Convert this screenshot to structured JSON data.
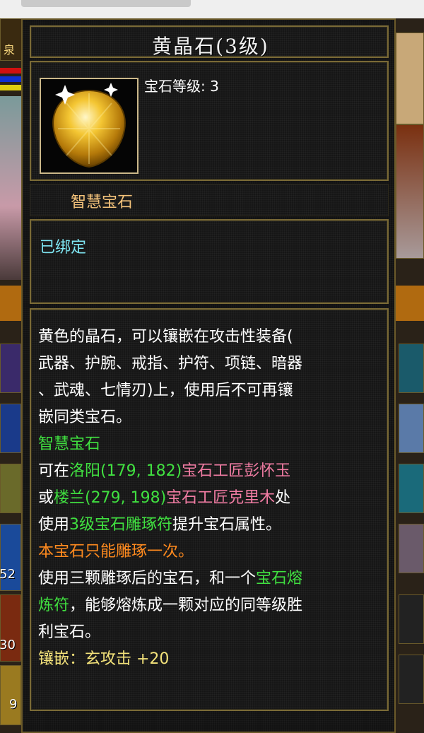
{
  "tooltip": {
    "title": "黄晶石(3级)",
    "gem_level": "宝石等级: 3",
    "category": "智慧宝石",
    "bound": "已绑定",
    "description": {
      "lines": [
        "黄色的晶石，可以镶嵌在攻击性装备(",
        "武器、护腕、戒指、护符、项链、暗器",
        "、武魂、七情刃)上，使用后不可再镶",
        "嵌同类宝石。"
      ],
      "type_label": "智慧宝石",
      "craft": {
        "line1_prefix": "可在",
        "loc1": "洛阳(179, 182)",
        "npc1": "宝石工匠彭怀玉",
        "line2_prefix": "或",
        "loc2": "楼兰(279, 198)",
        "npc2": "宝石工匠克里木",
        "line2_suffix": "处",
        "line3_prefix": "使用",
        "item": "3级宝石雕琢符",
        "line3_suffix": "提升宝石属性。"
      },
      "warning": "本宝石只能雕琢一次。",
      "fuse": {
        "part1": "使用三颗雕琢后的宝石，和一个",
        "item": "宝石熔",
        "item2": "炼符",
        "part2": "，能够熔炼成一颗对应的同等级胜",
        "part3": "利宝石。"
      },
      "stat": "镶嵌：玄攻击 +20"
    }
  },
  "background": {
    "left_numbers": [
      "52",
      "30",
      "9"
    ],
    "left_label": "泉"
  },
  "colors": {
    "green": "#40e040",
    "pink": "#f17ca3",
    "orange": "#ff8a1e",
    "yellow": "#f3e27a",
    "cyan": "#7fe6f3",
    "gold_border": "#7a6a36"
  },
  "icons": [
    "gem-yellow-icon"
  ]
}
